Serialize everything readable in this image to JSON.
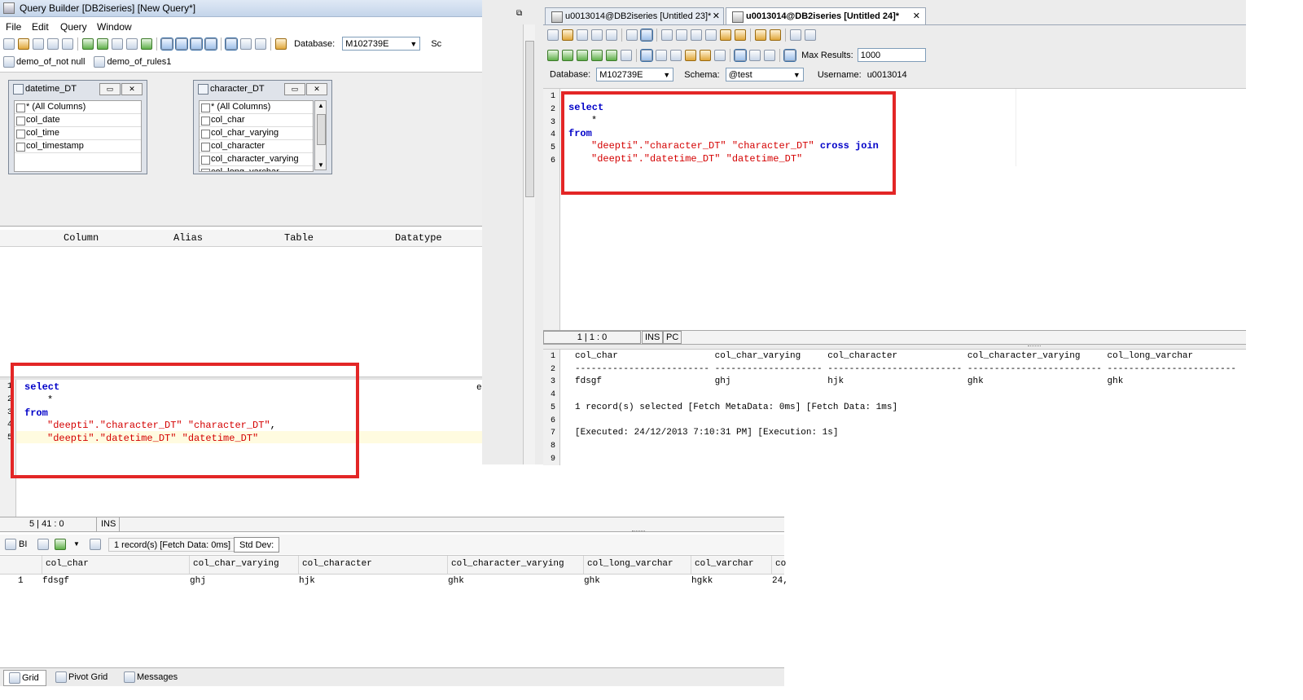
{
  "qb": {
    "title": "Query Builder [DB2iseries] [New Query*]",
    "menu": [
      "File",
      "Edit",
      "Query",
      "Window"
    ],
    "database_label": "Database:",
    "database_value": "M102739E",
    "schema_label_cut": "Sc",
    "quick_tabs": [
      "demo_of_not null",
      "demo_of_rules1"
    ],
    "tables": [
      {
        "name": "datetime_DT",
        "columns": [
          "* (All Columns)",
          "col_date",
          "col_time",
          "col_timestamp"
        ]
      },
      {
        "name": "character_DT",
        "columns": [
          "* (All Columns)",
          "col_char",
          "col_char_varying",
          "col_character",
          "col_character_varying",
          "col_long_varchar"
        ]
      }
    ],
    "grid_headers": [
      "Column",
      "Alias",
      "Table",
      "Datatype"
    ],
    "sql_lines": [
      {
        "num": "1",
        "kw": "select",
        "str": "",
        "rest": ""
      },
      {
        "num": "2",
        "kw": "",
        "str": "",
        "rest": "*"
      },
      {
        "num": "3",
        "kw": "from",
        "str": "",
        "rest": ""
      },
      {
        "num": "4",
        "kw": "",
        "str": "\"deepti\".\"character_DT\" \"character_DT\"",
        "rest": ","
      },
      {
        "num": "5",
        "kw": "",
        "str": "\"deepti\".\"datetime_DT\" \"datetime_DT\"",
        "rest": ""
      }
    ],
    "side_cut_text": "es",
    "status_pos": "5 | 41 : 0",
    "status_mode": "INS",
    "results_toolbar": {
      "bi": "BI",
      "record_text": "1 record(s) [Fetch Data: 0ms]",
      "std_dev": "Std Dev:"
    },
    "result_headers": [
      "col_char",
      "col_char_varying",
      "col_character",
      "col_character_varying",
      "col_long_varchar",
      "col_varchar",
      "co"
    ],
    "result_rows": [
      {
        "num": "1",
        "cells": [
          "fdsgf",
          "ghj",
          "hjk",
          "ghk",
          "ghk",
          "hgkk",
          "24,"
        ]
      }
    ],
    "bottom_tabs": [
      "Grid",
      "Pivot Grid",
      "Messages"
    ]
  },
  "ed": {
    "tabs": [
      {
        "label": "u0013014@DB2iseries [Untitled 23]*",
        "active": false
      },
      {
        "label": "u0013014@DB2iseries [Untitled 24]*",
        "active": true
      }
    ],
    "max_results_label": "Max Results:",
    "max_results_value": "1000",
    "database_label": "Database:",
    "database_value": "M102739E",
    "schema_label": "Schema:",
    "schema_value": "@test",
    "username_label": "Username:",
    "username_value": "u0013014",
    "sql_line_numbers": [
      "1",
      "2",
      "3",
      "4",
      "5",
      "6"
    ],
    "sql_lines": [
      {
        "kw": "select",
        "str": "",
        "rest": "",
        "kw2": ""
      },
      {
        "kw": "",
        "str": "",
        "rest": "*",
        "kw2": ""
      },
      {
        "kw": "from",
        "str": "",
        "rest": "",
        "kw2": ""
      },
      {
        "kw": "",
        "str": "\"deepti\".\"character_DT\" \"character_DT\"",
        "rest": "",
        "kw2": "cross join"
      },
      {
        "kw": "",
        "str": "\"deepti\".\"datetime_DT\" \"datetime_DT\"",
        "rest": "",
        "kw2": ""
      }
    ],
    "status_pos": "1 | 1 : 0",
    "status_mode": "INS",
    "status_pc": "PC",
    "result_line_numbers": [
      "1",
      "2",
      "3",
      "4",
      "5",
      "6",
      "7",
      "8",
      "9"
    ],
    "result_lines": [
      "col_char                  col_char_varying     col_character             col_character_varying     col_long_varchar",
      "------------------------- -------------------- ------------------------- ------------------------- ------------------------",
      "fdsgf                     ghj                  hjk                       ghk                       ghk",
      "",
      "1 record(s) selected [Fetch MetaData: 0ms] [Fetch Data: 1ms]",
      "",
      "[Executed: 24/12/2013 7:10:31 PM] [Execution: 1s]",
      "",
      ""
    ]
  },
  "colors": {
    "highlight_box": "#e32626",
    "keyword": "#0000c8",
    "string": "#d40000"
  }
}
